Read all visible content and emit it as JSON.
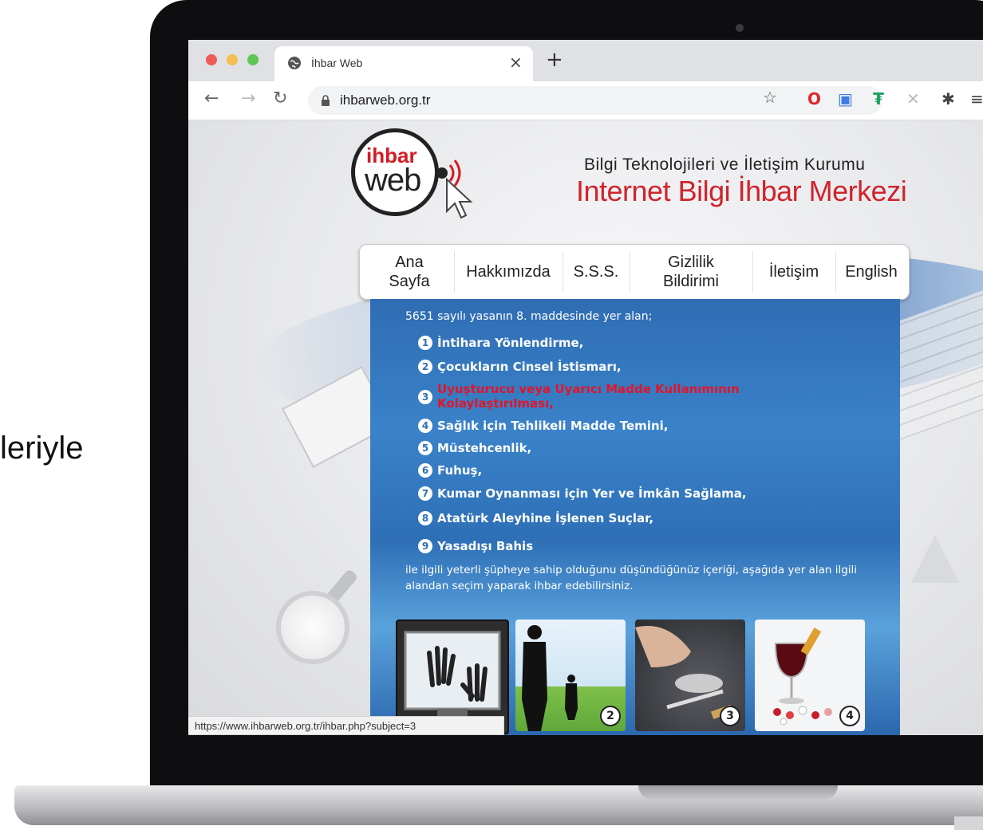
{
  "slide": {
    "side_text": "leriyle"
  },
  "browser": {
    "tab_title": "İhbar Web",
    "tab_close": "×",
    "new_tab": "+",
    "url": "ihbarweb.org.tr",
    "status_url": "https://www.ihbarweb.org.tr/ihbar.php?subject=3",
    "traffic_colors": [
      "#ee5b56",
      "#f6be50",
      "#5fc654"
    ]
  },
  "site": {
    "logo": {
      "top": "ihbar",
      "bottom": "web"
    },
    "header_line1": "Bilgi Teknolojileri ve İletişim Kurumu",
    "header_line2": "Internet Bilgi İhbar Merkezi",
    "nav": [
      {
        "label": "Ana Sayfa"
      },
      {
        "label": "Hakkımızda"
      },
      {
        "label": "S.S.S."
      },
      {
        "label": "Gizlilik Bildirimi"
      },
      {
        "label": "İletişim"
      },
      {
        "label": "English"
      }
    ],
    "intro": "5651 sayılı yasanın 8. maddesinde yer alan;",
    "items": [
      {
        "num": "1",
        "text": "İntihara Yönlendirme,"
      },
      {
        "num": "2",
        "text": "Çocukların Cinsel İstismarı,"
      },
      {
        "num": "3",
        "text": "Uyuşturucu veya Uyarıcı Madde Kullanımının Kolaylaştırılması,"
      },
      {
        "num": "4",
        "text": "Sağlık için Tehlikeli Madde Temini,"
      },
      {
        "num": "5",
        "text": "Müstehcenlik,"
      },
      {
        "num": "6",
        "text": "Fuhuş,"
      },
      {
        "num": "7",
        "text": "Kumar Oynanması için Yer ve İmkân Sağlama,"
      },
      {
        "num": "8",
        "text": "Atatürk Aleyhine İşlenen Suçlar,"
      },
      {
        "num": "9",
        "text": "Yasadışı Bahis"
      }
    ],
    "outro": "ile ilgili yeterli şüpheye sahip olduğunu düşündüğünüz içeriği, aşağıda yer alan ilgili alandan seçim yaparak ihbar edebilirsiniz.",
    "thumbnails": [
      {
        "num": "",
        "icon": "hands-on-screen"
      },
      {
        "num": "2",
        "icon": "adult-and-child-silhouette"
      },
      {
        "num": "3",
        "icon": "powder-and-syringe"
      },
      {
        "num": "4",
        "icon": "wine-glass-and-pills"
      }
    ],
    "colors": {
      "brand_red": "#d0242b",
      "panel_blue": "#2f6db3"
    }
  }
}
